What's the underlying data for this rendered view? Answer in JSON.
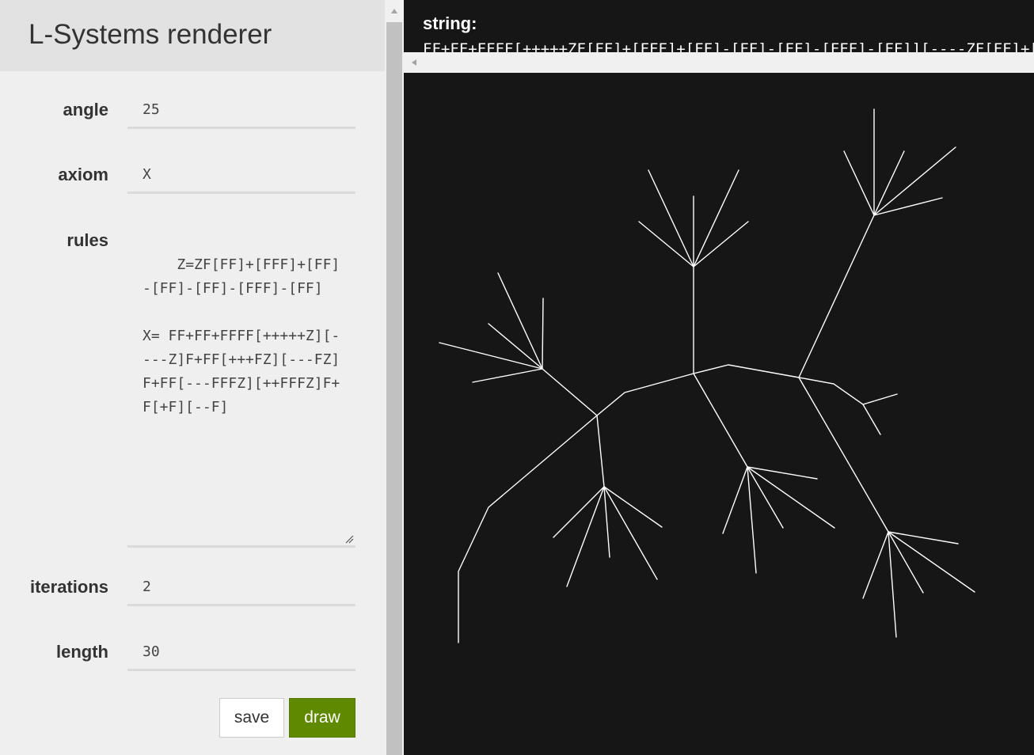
{
  "app": {
    "title": "L-Systems renderer"
  },
  "form": {
    "angle": {
      "label": "angle",
      "value": "25"
    },
    "axiom": {
      "label": "axiom",
      "value": "X"
    },
    "rules": {
      "label": "rules",
      "value": "Z=ZF[FF]+[FFF]+[FF]-[FF]-[FF]-[FFF]-[FF]\n\nX= FF+FF+FFFF[+++++Z][----Z]F+FF[+++FZ][---FZ]F+FF[---FFFZ][++FFFZ]F+F[+F][--F]"
    },
    "iterations": {
      "label": "iterations",
      "value": "2"
    },
    "length": {
      "label": "length",
      "value": "30"
    },
    "save_label": "save",
    "draw_label": "draw"
  },
  "output": {
    "string_label": "string:",
    "string_value": "FF+FF+FFFF[+++++ZF[FF]+[FFF]+[FF]-[FF]-[FF]-[FFF]-[FF]][----ZF[FF]+[FFF]+[FF]-[FF]-[FF]-[FFF]-[FF]]"
  },
  "icons": {
    "scroll_up": "triangle-up-icon",
    "scroll_left": "triangle-left-icon",
    "resize": "resize-grip-icon"
  },
  "colors": {
    "draw_button": "#5f8a00",
    "canvas_background": "#161616",
    "stroke": "#ffffff"
  }
}
